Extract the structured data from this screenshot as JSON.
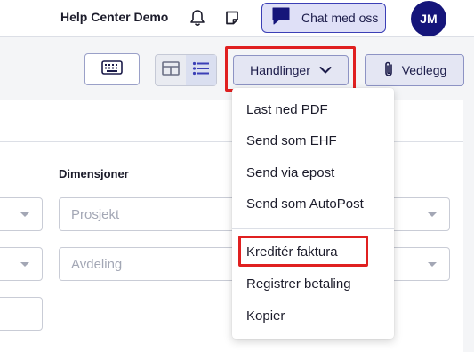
{
  "header": {
    "company_name": "Help Center Demo",
    "notifications_icon": "bell-icon",
    "notes_icon": "note-icon",
    "chat_button_label": "Chat med oss",
    "chat_icon": "chat-bubble-icon",
    "avatar_initials": "JM",
    "avatar_color": "#15157a"
  },
  "toolbar": {
    "keyboard_icon": "keyboard-icon",
    "view_toggle": {
      "options": [
        "grid-view-icon",
        "list-view-icon"
      ],
      "active": "list-view-icon"
    },
    "actions_button_label": "Handlinger",
    "actions_button_icon": "chevron-down-icon",
    "attachments_button_label": "Vedlegg",
    "attachments_icon": "paperclip-icon"
  },
  "form": {
    "dimensions_label": "Dimensjoner",
    "project_placeholder": "Prosjekt",
    "department_placeholder": "Avdeling"
  },
  "actions_menu": {
    "items": [
      {
        "label": "Last ned PDF"
      },
      {
        "label": "Send som EHF"
      },
      {
        "label": "Send via epost"
      },
      {
        "label": "Send som AutoPost"
      },
      {
        "label": "Kreditér faktura",
        "highlighted": true
      },
      {
        "label": "Registrer betaling"
      },
      {
        "label": "Kopier"
      }
    ]
  },
  "colors": {
    "highlight": "#e02020",
    "accent": "#3b3fb6",
    "button_bg": "#e4e6f3"
  }
}
